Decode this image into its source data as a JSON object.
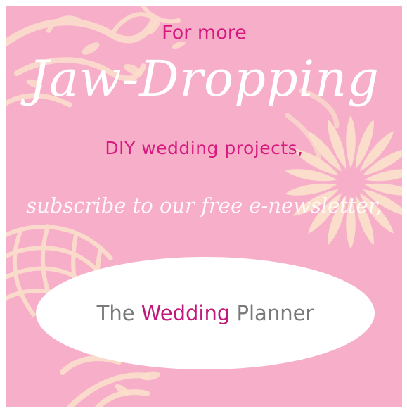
{
  "promo": {
    "line1": "For more",
    "line2": "Jaw-Dropping",
    "line3": "DIY wedding projects,",
    "line4": "subscribe to our free e-newsletter,"
  },
  "brand": {
    "part1": "The",
    "part2": "Wedding",
    "part3": "Planner"
  },
  "colors": {
    "background": "#f7afc9",
    "accent": "#d6197f",
    "ornament": "#fbe3cf",
    "text_gray": "#7a7a7a",
    "oval": "#ffffff"
  }
}
